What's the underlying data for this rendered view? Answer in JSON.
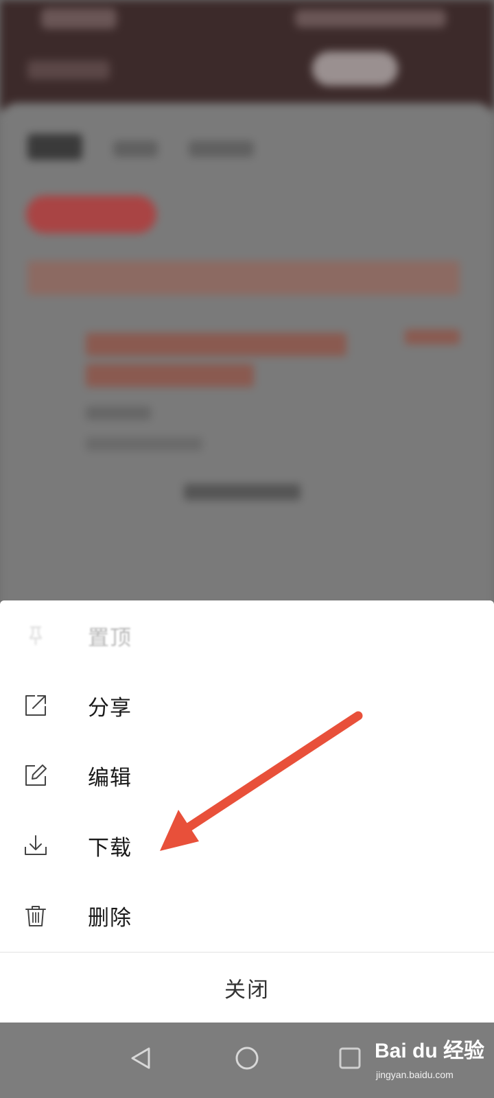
{
  "menu": {
    "items": [
      {
        "label": "置顶",
        "icon": "pin-icon",
        "enabled": false
      },
      {
        "label": "分享",
        "icon": "share-icon",
        "enabled": true
      },
      {
        "label": "编辑",
        "icon": "edit-icon",
        "enabled": true
      },
      {
        "label": "下载",
        "icon": "download-icon",
        "enabled": true
      },
      {
        "label": "删除",
        "icon": "trash-icon",
        "enabled": true
      }
    ],
    "close_label": "关闭"
  },
  "annotation": {
    "color": "#e8503a",
    "points_to": "下载"
  },
  "navbar": {
    "buttons": [
      "back-icon",
      "home-icon",
      "recents-icon"
    ]
  },
  "watermark": {
    "brand": "Bai du 经验",
    "url": "jingyan.baidu.com"
  },
  "colors": {
    "header": "#3c2a2a",
    "accent_red": "#e8503a",
    "sheet_bg": "#ffffff"
  }
}
